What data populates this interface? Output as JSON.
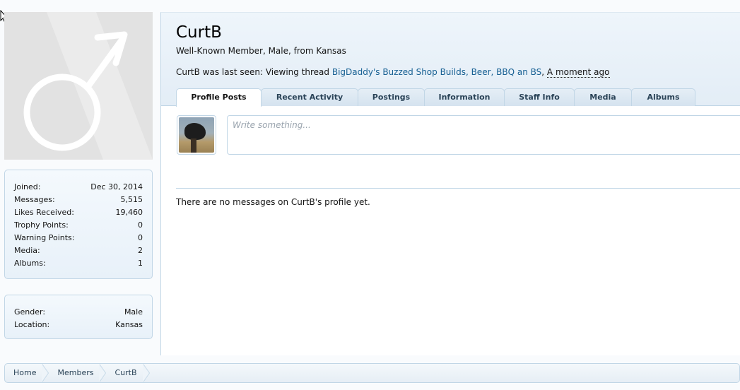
{
  "profile": {
    "name": "CurtB",
    "title": "Well-Known Member, Male, from Kansas",
    "last_seen_prefix": "CurtB was last seen: Viewing thread ",
    "last_seen_thread": "BigDaddy's Buzzed Shop Builds, Beer, BBQ an BS",
    "last_seen_sep": ", ",
    "last_seen_time": "A moment ago"
  },
  "tabs": [
    {
      "label": "Profile Posts",
      "active": true
    },
    {
      "label": "Recent Activity"
    },
    {
      "label": "Postings"
    },
    {
      "label": "Information"
    },
    {
      "label": "Staff Info"
    },
    {
      "label": "Media"
    },
    {
      "label": "Albums"
    }
  ],
  "stats": [
    {
      "label": "Joined:",
      "value": "Dec 30, 2014"
    },
    {
      "label": "Messages:",
      "value": "5,515"
    },
    {
      "label": "Likes Received:",
      "value": "19,460"
    },
    {
      "label": "Trophy Points:",
      "value": "0"
    },
    {
      "label": "Warning Points:",
      "value": "0"
    },
    {
      "label": "Media:",
      "value": "2"
    },
    {
      "label": "Albums:",
      "value": "1"
    }
  ],
  "info": [
    {
      "label": "Gender:",
      "value": "Male"
    },
    {
      "label": "Location:",
      "value": "Kansas"
    }
  ],
  "post_box": {
    "placeholder": "Write something..."
  },
  "empty_message": "There are no messages on CurtB's profile yet.",
  "breadcrumb": [
    "Home",
    "Members",
    "CurtB"
  ],
  "icons": {
    "avatar": "male-symbol-icon",
    "cursor": "mouse-cursor-icon"
  },
  "colors": {
    "accent": "#176093",
    "border": "#c1d6e6",
    "tab_bg": "#d5e3ef"
  }
}
